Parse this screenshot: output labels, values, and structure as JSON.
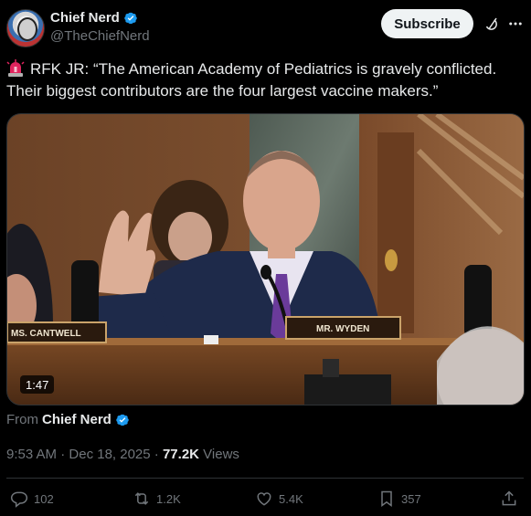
{
  "author": {
    "name": "Chief Nerd",
    "handle": "@TheChiefNerd",
    "avatar_label": "CHIEF NERD"
  },
  "header": {
    "subscribe_label": "Subscribe"
  },
  "post": {
    "text": "RFK JR: “The American Academy of Pediatrics is gravely conflicted. Their biggest contributors are the four largest vaccine makers.”"
  },
  "video": {
    "duration": "1:47",
    "nameplate_left": "MS. CANTWELL",
    "nameplate_center": "MR. WYDEN"
  },
  "source": {
    "prefix": "From",
    "name": "Chief Nerd"
  },
  "meta": {
    "time": "9:53 AM",
    "separator": "·",
    "date": "Dec 18, 2025",
    "views_count": "77.2K",
    "views_label": "Views"
  },
  "actions": {
    "replies": "102",
    "reposts": "1.2K",
    "likes": "5.4K",
    "bookmarks": "357"
  },
  "colors": {
    "background": "#000000",
    "text": "#e7e9ea",
    "muted": "#71767b",
    "verified": "#1d9bf0",
    "divider": "#2f3336"
  }
}
